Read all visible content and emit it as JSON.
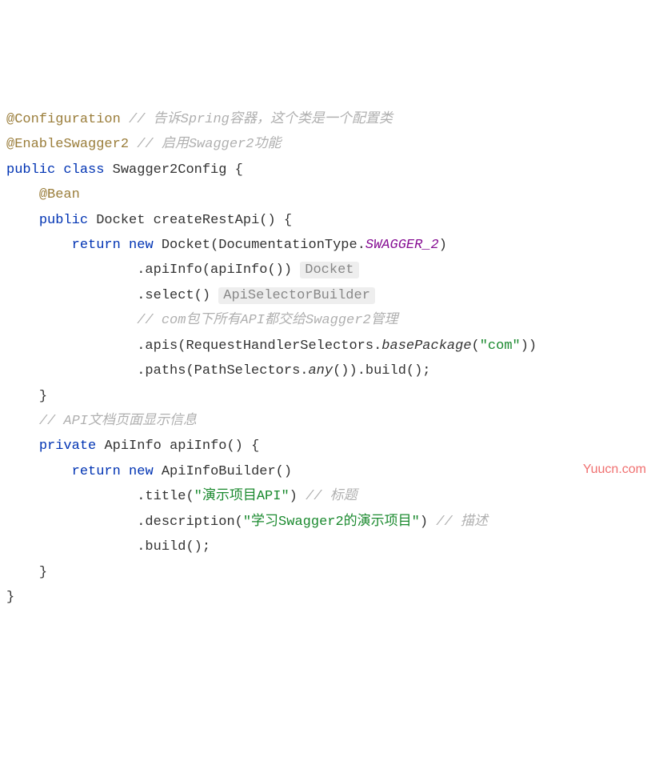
{
  "code": {
    "l1_annotation": "@Configuration",
    "l1_comment": "// 告诉Spring容器，这个类是一个配置类",
    "l2_annotation": "@EnableSwagger2",
    "l2_comment": "// 启用Swagger2功能",
    "l3_public": "public",
    "l3_class": "class",
    "l3_name": "Swagger2Config",
    "l3_brace": "{",
    "l4_bean": "@Bean",
    "l5_public": "public",
    "l5_type": "Docket",
    "l5_method": "createRestApi",
    "l5_paren": "() {",
    "l6_return": "return",
    "l6_new": "new",
    "l6_ctor": "Docket(DocumentationType.",
    "l6_const": "SWAGGER_2",
    "l6_close": ")",
    "l7_call": ".apiInfo(apiInfo())",
    "l7_hint": "Docket",
    "l8_call": ".select()",
    "l8_hint": "ApiSelectorBuilder",
    "l9_comment": "// com包下所有API都交给Swagger2管理",
    "l10_call_a": ".apis(RequestHandlerSelectors.",
    "l10_static": "basePackage",
    "l10_paren_open": "(",
    "l10_string": "\"com\"",
    "l10_close": "))",
    "l11_call_a": ".paths(PathSelectors.",
    "l11_static": "any",
    "l11_close": "()).build();",
    "l12_brace": "}",
    "l13_comment": "// API文档页面显示信息",
    "l14_private": "private",
    "l14_type": "ApiInfo",
    "l14_method": "apiInfo",
    "l14_paren": "() {",
    "l15_return": "return",
    "l15_new": "new",
    "l15_ctor": "ApiInfoBuilder()",
    "l16_call_a": ".title(",
    "l16_string": "\"演示项目API\"",
    "l16_close": ")",
    "l16_comment": "// 标题",
    "l17_call_a": ".description(",
    "l17_string": "\"学习Swagger2的演示项目\"",
    "l17_close": ")",
    "l17_comment": "// 描述",
    "l18_call": ".build();",
    "l19_brace": "}",
    "l20_brace": "}"
  },
  "watermark": "Yuucn.com"
}
